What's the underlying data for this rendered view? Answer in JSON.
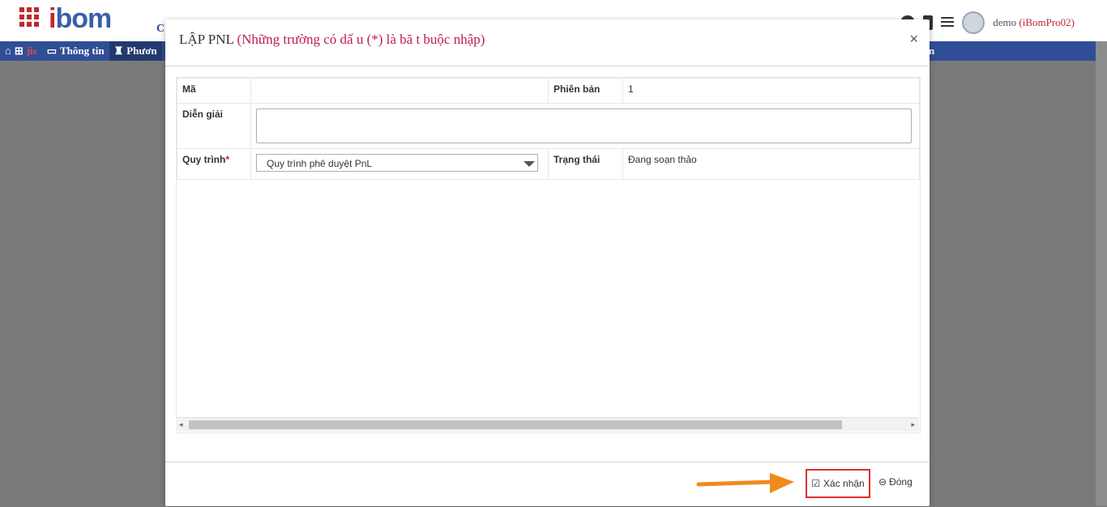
{
  "app": {
    "logo_prefix": "i",
    "logo_text": "bom",
    "header_partial": "C"
  },
  "user": {
    "name": "demo",
    "account": "(iBomPro02)"
  },
  "nav": {
    "item1_tag": "jis",
    "item2": "Thông tin",
    "item3": "Phươn",
    "item4": "n"
  },
  "modal": {
    "title": "LẬP PNL",
    "required_note": "(Những trường có dấ u (*) là bă t buộc nhập)",
    "close_symbol": "×",
    "fields": {
      "ma_label": "Mã",
      "ma_value": "",
      "version_label": "Phiên bản",
      "version_value": "1",
      "desc_label": "Diễn giải",
      "desc_value": "",
      "process_label": "Quy trình",
      "process_required": "*",
      "process_value": "Quy trình phê duyệt PnL",
      "status_label": "Trạng thái",
      "status_value": "Đang soạn thảo"
    },
    "buttons": {
      "confirm": "Xác nhận",
      "close": "Đóng"
    }
  },
  "colors": {
    "brand_blue": "#2f4e96",
    "brand_red": "#c0272d",
    "highlight": "#e02d2d",
    "arrow": "#f08a1c"
  },
  "icons": {
    "confirm": "check-square-icon",
    "close": "minus-circle-icon"
  }
}
